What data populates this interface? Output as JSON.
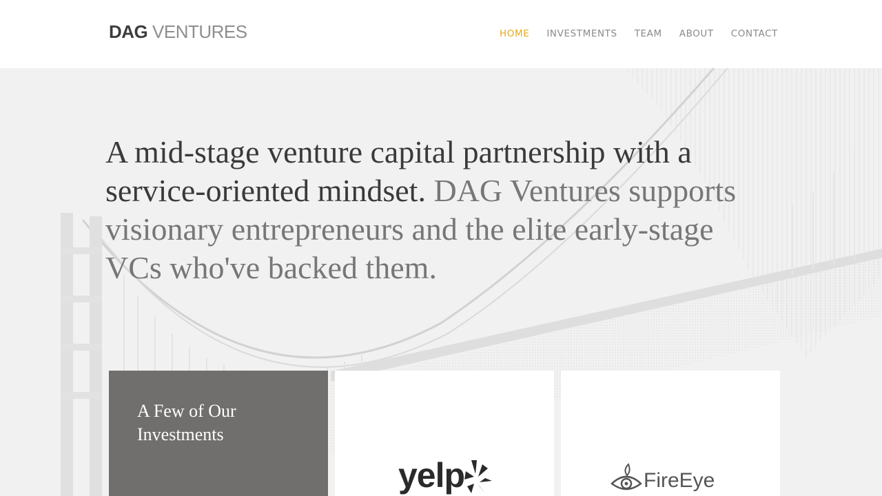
{
  "header": {
    "logo_bold": "DAG",
    "logo_light": " VENTURES",
    "nav": [
      {
        "label": "HOME",
        "active": true
      },
      {
        "label": "INVESTMENTS",
        "active": false
      },
      {
        "label": "TEAM",
        "active": false
      },
      {
        "label": "ABOUT",
        "active": false
      },
      {
        "label": "CONTACT",
        "active": false
      }
    ]
  },
  "hero": {
    "headline_dark": "A mid-stage venture capital partnership with a service-oriented mindset.",
    "headline_muted": " DAG Ventures supports visionary entrepreneurs and the elite early-stage VCs who've backed them."
  },
  "investments": {
    "title": "A Few of Our Investments",
    "logos": [
      {
        "name": "yelp",
        "text": "yelp"
      },
      {
        "name": "fireeye",
        "text": "FireEye"
      }
    ]
  },
  "colors": {
    "accent": "#e4aa18",
    "nav_text": "#8a8a8a",
    "hero_bg": "#f1f1f1",
    "card_dark": "#706f6d"
  }
}
